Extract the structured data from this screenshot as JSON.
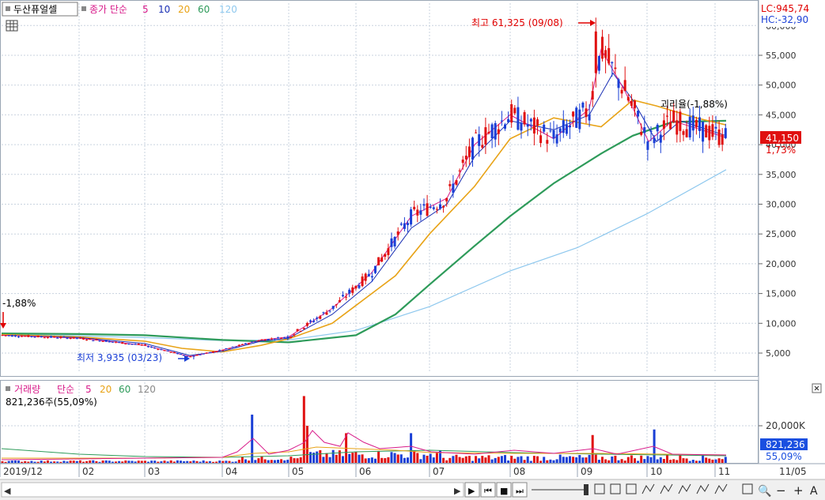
{
  "price_panel": {
    "stock_name": "두산퓨얼셀",
    "legend_prefix": "종가 단순",
    "ma_periods": [
      "5",
      "10",
      "20",
      "60",
      "120"
    ],
    "ma_colors": [
      "#d81b8a",
      "#1a2fb4",
      "#e8a317",
      "#2e9b5a",
      "#8ec8ee"
    ],
    "lc_label": "LC:945,74",
    "hc_label": "HC:-32,90",
    "high_label": "최고 61,325 (09/08)",
    "low_label": "최저 3,935 (03/23)",
    "left_change_label": "-1,88%",
    "right_change_label": "괴리율(-1,88%)",
    "current_price": "41,150",
    "current_change": "1,73%",
    "y_ticks": [
      "55,000",
      "50,000",
      "45,000",
      "40,000",
      "35,000",
      "30,000",
      "25,000",
      "20,000",
      "15,000",
      "10,000",
      "5,000"
    ],
    "y_tick_values": [
      55000,
      50000,
      45000,
      40000,
      35000,
      30000,
      25000,
      20000,
      15000,
      10000,
      5000
    ],
    "y_top_partial": "60,000"
  },
  "volume_panel": {
    "title": "거래량",
    "legend_prefix": "단순",
    "ma_periods": [
      "5",
      "20",
      "60",
      "120"
    ],
    "ma_colors": [
      "#d81b8a",
      "#e8a317",
      "#2e9b5a",
      "#888888"
    ],
    "current_volume": "821,236주(55,09%)",
    "y_tick": "20,000K",
    "y_tick_value": 20000000,
    "current_badge": "821,236",
    "current_pct": "55,09%"
  },
  "x_axis": {
    "labels": [
      "2019/12",
      "02",
      "03",
      "04",
      "05",
      "06",
      "07",
      "08",
      "09",
      "10",
      "11"
    ],
    "right_date": "11/05"
  },
  "chart_data": {
    "type": "candlestick",
    "title": "두산퓨얼셀",
    "ylim": [
      0,
      61325
    ],
    "grid": true,
    "legend_placement": "top-left",
    "x": [
      "2019-12",
      "2020-01",
      "2020-02",
      "2020-03",
      "2020-04",
      "2020-05",
      "2020-06",
      "2020-07",
      "2020-08",
      "2020-09",
      "2020-10",
      "2020-11"
    ],
    "series": [
      {
        "name": "종가",
        "values": [
          8200,
          7900,
          7500,
          4500,
          6500,
          8800,
          14000,
          31000,
          44000,
          52000,
          42000,
          41150
        ]
      },
      {
        "name": "5",
        "values": [
          8200,
          7900,
          7400,
          4600,
          6600,
          9200,
          15000,
          30000,
          43000,
          51000,
          41500,
          41500
        ]
      },
      {
        "name": "10",
        "values": [
          8200,
          7950,
          7450,
          4700,
          6400,
          9000,
          14000,
          29000,
          42500,
          50000,
          42500,
          41800
        ]
      },
      {
        "name": "20",
        "values": [
          8100,
          8000,
          7600,
          5000,
          6100,
          8000,
          13000,
          27000,
          41000,
          48000,
          43500,
          43000
        ]
      },
      {
        "name": "60",
        "values": [
          8000,
          8000,
          7900,
          7000,
          6500,
          7000,
          10000,
          17500,
          31000,
          40000,
          44000,
          44000
        ]
      },
      {
        "name": "120",
        "values": [
          7800,
          7800,
          7800,
          7400,
          7000,
          7200,
          8500,
          12500,
          19000,
          26000,
          32000,
          35500
        ]
      }
    ],
    "annotations": [
      {
        "label": "최고 61,325 (09/08)",
        "value": 61325
      },
      {
        "label": "최저 3,935 (03/23)",
        "value": 3935
      }
    ],
    "volume": {
      "name": "거래량",
      "current": 821236,
      "unit_tick": "20,000K"
    }
  },
  "toolbar": {
    "left_arrow": "◀",
    "right_arrow": "▶",
    "buttons": [
      "▶",
      "⏮",
      "■",
      "⏭"
    ],
    "zoom_buttons": [
      "🔍",
      "−",
      "+",
      "A"
    ]
  }
}
